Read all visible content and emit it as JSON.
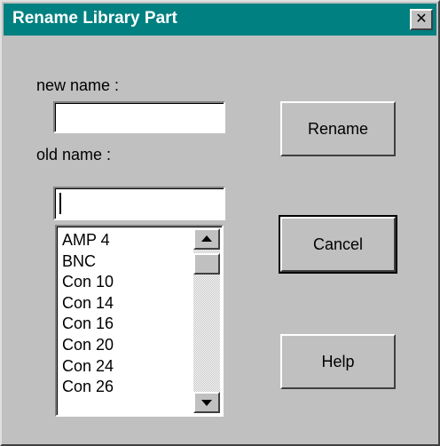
{
  "window": {
    "title": "Rename Library Part",
    "close_glyph": "✕"
  },
  "form": {
    "new_name_label": "new name :",
    "new_name_value": "",
    "old_name_label": "old name :",
    "old_name_value": ""
  },
  "buttons": {
    "rename": "Rename",
    "cancel": "Cancel",
    "help": "Help"
  },
  "parts_list": {
    "items": [
      "AMP 4",
      "BNC",
      "Con 10",
      "Con 14",
      "Con 16",
      "Con 20",
      "Con 24",
      "Con 26"
    ]
  },
  "icons": {
    "close": "close-icon",
    "scroll_up": "scroll-up-arrow-icon",
    "scroll_down": "scroll-down-arrow-icon"
  },
  "colors": {
    "titlebar": "#008080",
    "dialog_face": "#c0c0c0"
  }
}
